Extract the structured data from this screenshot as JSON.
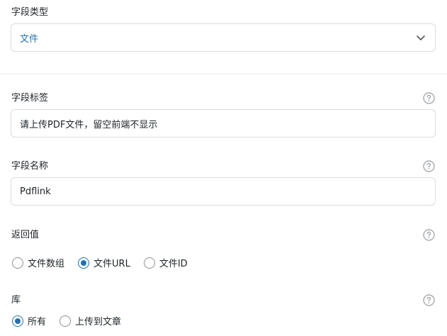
{
  "field_type": {
    "label": "字段类型",
    "value": "文件"
  },
  "field_label": {
    "label": "字段标签",
    "value": "请上传PDF文件，留空前端不显示"
  },
  "field_name": {
    "label": "字段名称",
    "value": "Pdflink"
  },
  "return_value": {
    "label": "返回值",
    "options": [
      {
        "label": "文件数组",
        "checked": false
      },
      {
        "label": "文件URL",
        "checked": true
      },
      {
        "label": "文件ID",
        "checked": false
      }
    ]
  },
  "library": {
    "label": "库",
    "options": [
      {
        "label": "所有",
        "checked": true
      },
      {
        "label": "上传到文章",
        "checked": false
      }
    ]
  },
  "colors": {
    "accent": "#2271b1",
    "border": "#dcdcde",
    "text": "#1d2327",
    "help_icon": "#a7aaad"
  },
  "icons": {
    "dropdown": "chevron-down-icon",
    "help": "question-circle-icon"
  }
}
